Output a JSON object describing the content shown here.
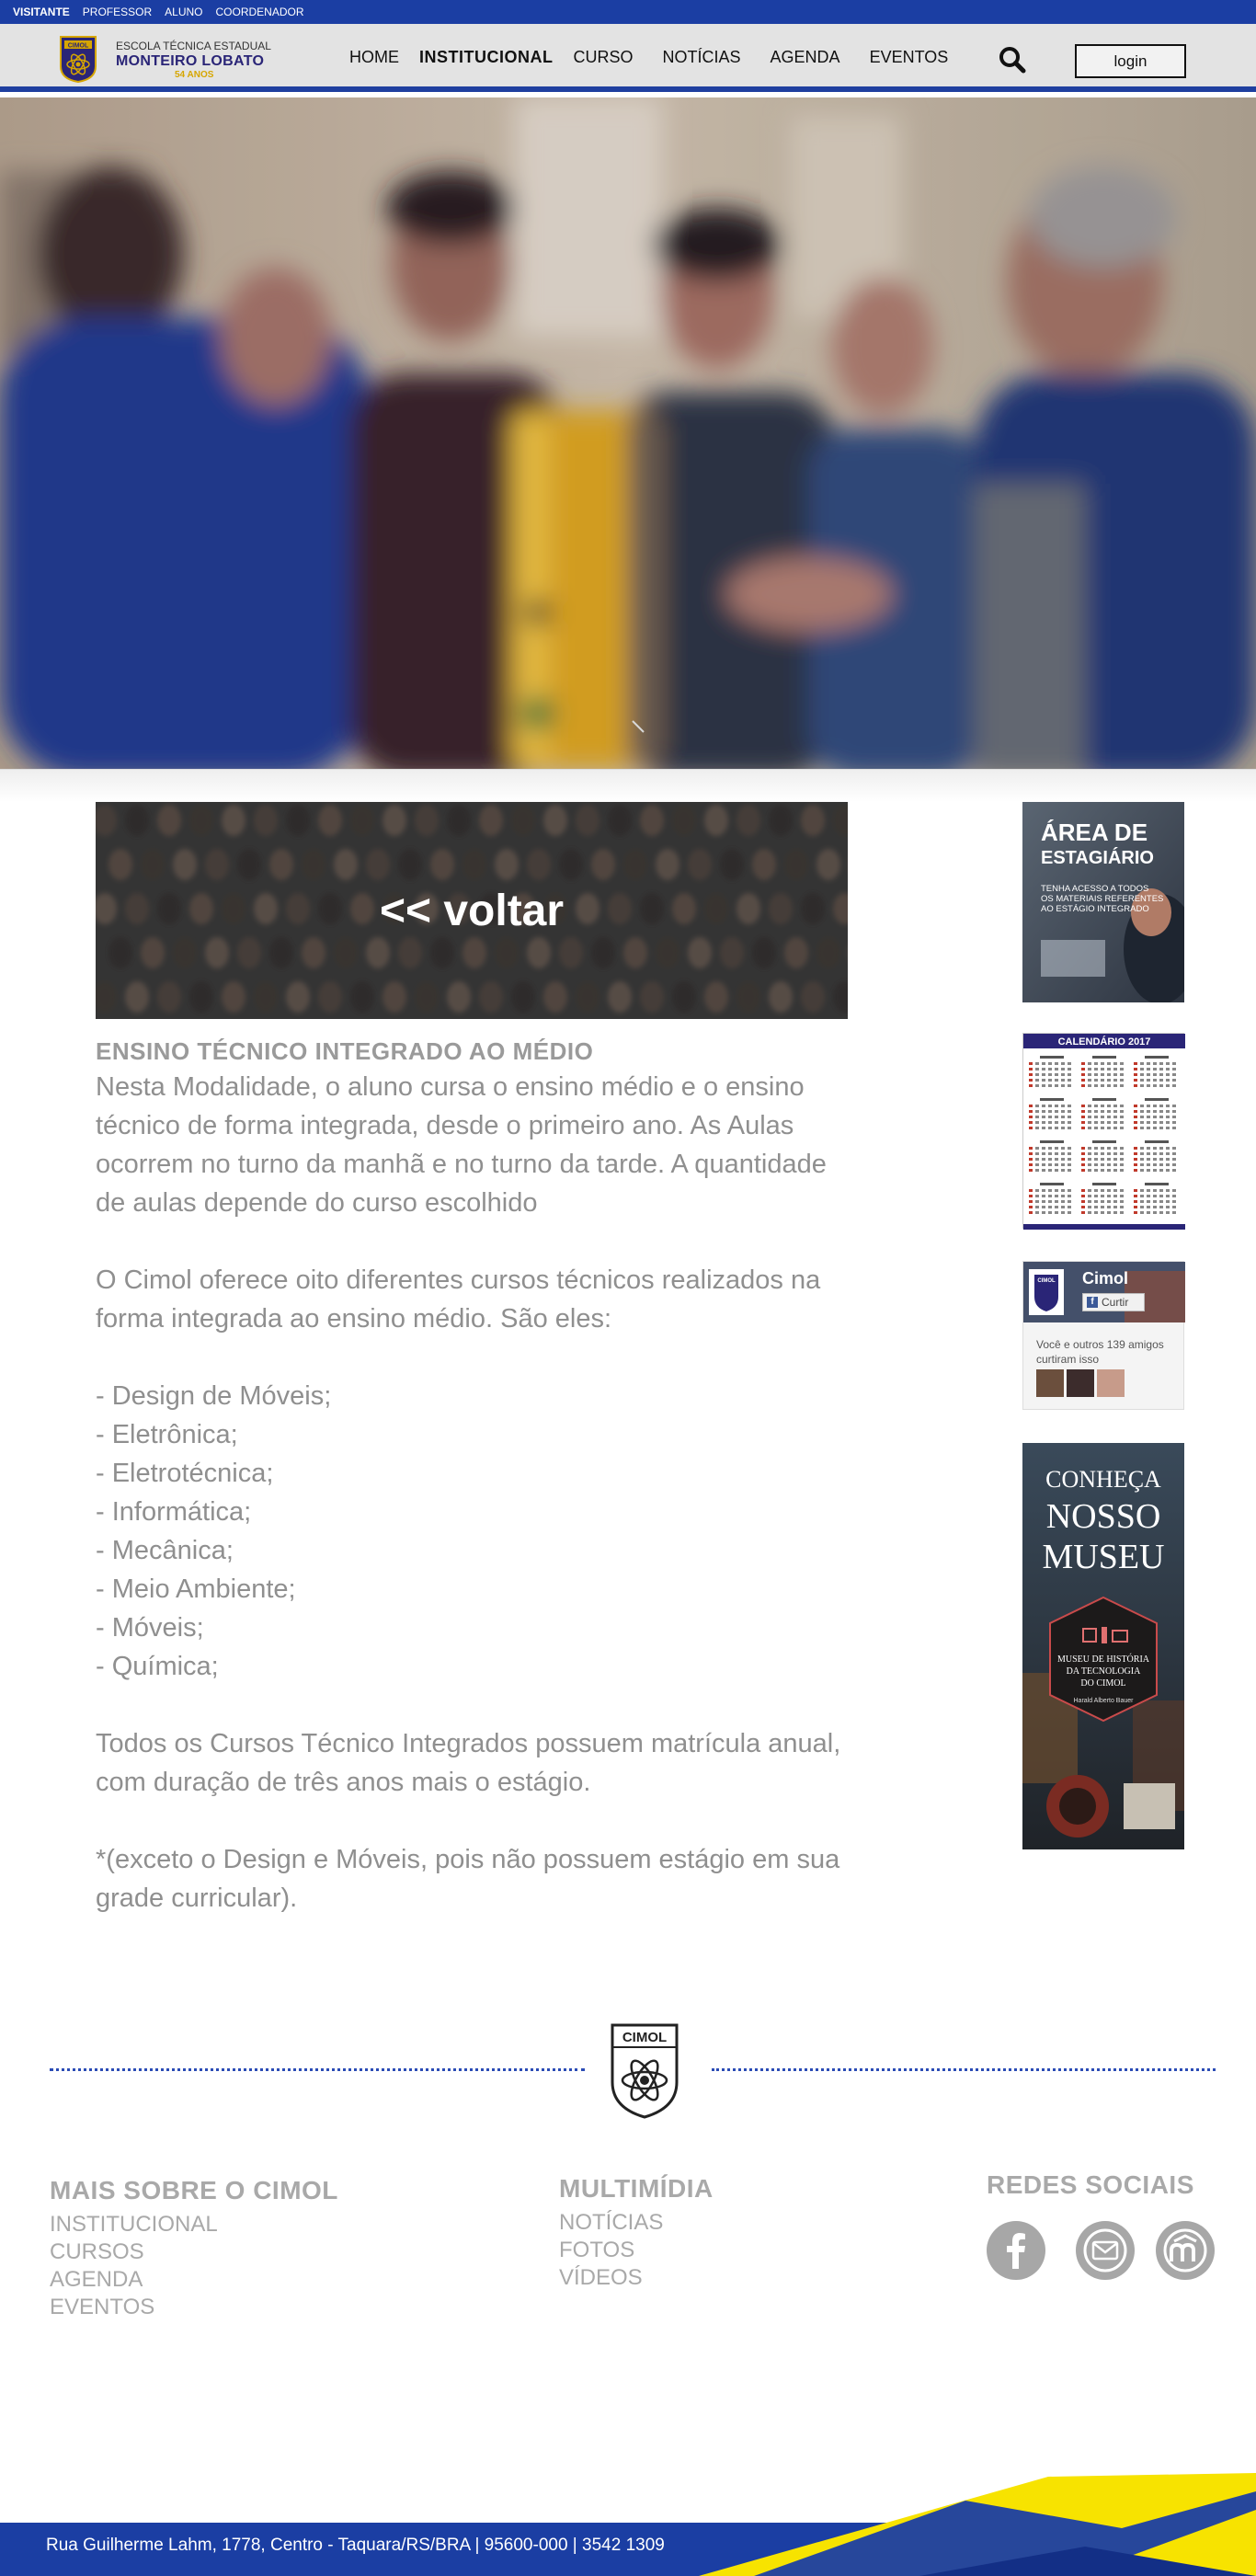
{
  "topbar": {
    "links": [
      "VISITANTE",
      "PROFESSOR",
      "ALUNO",
      "COORDENADOR"
    ]
  },
  "header": {
    "logo_text": "CIMOL",
    "school_line1": "ESCOLA TÉCNICA ESTADUAL",
    "school_line2": "MONTEIRO LOBATO",
    "school_line3": "54 ANOS",
    "nav": [
      "HOME",
      "INSTITUCIONAL",
      "CURSO",
      "NOTÍCIAS",
      "AGENDA",
      "EVENTOS"
    ],
    "login_label": "login"
  },
  "content": {
    "back_label": "<< voltar",
    "title": "ENSINO TÉCNICO INTEGRADO AO MÉDIO",
    "intro": "Nesta Modalidade, o aluno cursa o ensino médio e o ensino técnico de forma integrada, desde o primeiro ano. As Aulas ocorrem no turno da manhã e no turno da tarde. A quantidade de aulas depende do curso escolhido",
    "offer": "O Cimol oferece oito diferentes cursos técnicos realizados na forma integrada ao ensino médio. São eles:",
    "courses": [
      "- Design de Móveis;",
      "- Eletrônica;",
      "- Eletrotécnica;",
      "- Informática;",
      "- Mecânica;",
      "- Meio Ambiente;",
      "- Móveis;",
      "- Química;"
    ],
    "duration": "Todos os Cursos Técnico Integrados possuem matrícula anual, com duração de três anos mais o estágio.",
    "note": "*(exceto o Design e Móveis, pois não possuem estágio em sua grade curricular)."
  },
  "sidebar": {
    "intern_title_1": "ÁREA DE",
    "intern_title_2": "ESTAGIÁRIO",
    "intern_text": "TENHA ACESSO A TODOS OS MATERIAIS REFERENTES AO ESTÁGIO INTEGRADO",
    "calendar_title": "CALENDÁRIO 2017",
    "fb_page": "Cimol",
    "fb_like": "Curtir",
    "fb_friends": "Você e outros 139 amigos curtiram isso",
    "museum_1": "CONHEÇA",
    "museum_2": "NOSSO",
    "museum_3": "MUSEU",
    "museum_badge_1": "MUSEU DE HISTÓRIA",
    "museum_badge_2": "DA TECNOLOGIA",
    "museum_badge_3": "DO CIMOL",
    "museum_badge_4": "Harald Alberto Bauer"
  },
  "footer": {
    "logo_text": "CIMOL",
    "col1_title": "MAIS SOBRE O CIMOL",
    "col1_links": [
      "INSTITUCIONAL",
      "CURSOS",
      "AGENDA",
      "EVENTOS"
    ],
    "col2_title": "MULTIMÍDIA",
    "col2_links": [
      "NOTÍCIAS",
      "FOTOS",
      "VÍDEOS"
    ],
    "col3_title": "REDES SOCIAIS",
    "address": "Rua Guilherme Lahm, 1778, Centro - Taquara/RS/BRA | 95600-000 | 3542 1309"
  },
  "colors": {
    "brand_blue": "#1b3ea3",
    "brand_yellow": "#f7e300",
    "text_grey": "#8f8f8f"
  }
}
